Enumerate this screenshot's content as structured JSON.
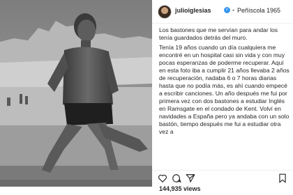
{
  "post": {
    "username": "julioiglesias",
    "location": "Peñíscola 1965",
    "caption": [
      "Los bastones que me servían para andar los tenía guardados detrás del muro.",
      "Tenía 19 años cuando un día cualquiera me encontré en un hospital casi sin vida y con muy pocas esperanzas de poderme recuperar. Aquí en esta foto iba a cumplir 21 años llevaba 2 años de recuperación, nadaba 6 o 7 horas diarias hasta que no podía más, es ahí cuando empecé a escribir canciones. Un año después me fui por primera vez con dos bastones a estudiar Inglés en Ramsgate en el condado de Kent. Volví en navidades a España pero ya andaba con un solo bastón, tiempo después me fui a estudiar otra vez a"
    ],
    "likes": "144,935 views"
  },
  "icons": {
    "verified": "verified-badge-icon",
    "like": "heart-icon",
    "comment": "comment-icon",
    "share": "share-icon",
    "save": "bookmark-icon"
  },
  "colors": {
    "verified_blue": "#3897f0",
    "text": "#262626",
    "muted": "#8e8e8e"
  }
}
